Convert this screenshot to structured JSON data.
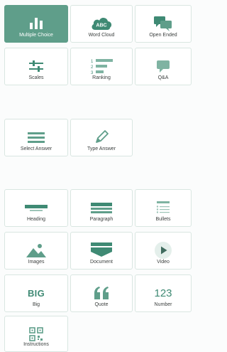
{
  "colors": {
    "accent": "#5f9e8a",
    "icon": "#3f8a74",
    "selected_text": "#ffffff",
    "label": "#3b3f3e"
  },
  "question_types": [
    {
      "label": "Multiple Choice",
      "icon": "bar-chart-icon",
      "selected": true
    },
    {
      "label": "Word Cloud",
      "icon": "word-cloud-icon",
      "icon_text": "ABC"
    },
    {
      "label": "Open Ended",
      "icon": "speech-bubbles-icon"
    },
    {
      "label": "Scales",
      "icon": "sliders-icon"
    },
    {
      "label": "Ranking",
      "icon": "ranking-icon",
      "icon_numbers": [
        "1",
        "2",
        "3"
      ]
    },
    {
      "label": "Q&A",
      "icon": "chat-bubble-icon"
    }
  ],
  "quiz_types": [
    {
      "label": "Select Answer",
      "icon": "list-lines-icon"
    },
    {
      "label": "Type Answer",
      "icon": "pencil-icon"
    }
  ],
  "content_types": [
    {
      "label": "Heading",
      "icon": "heading-icon"
    },
    {
      "label": "Paragraph",
      "icon": "paragraph-icon"
    },
    {
      "label": "Bullets",
      "icon": "bullets-icon"
    },
    {
      "label": "Images",
      "icon": "image-icon"
    },
    {
      "label": "Document",
      "icon": "document-icon"
    },
    {
      "label": "Video",
      "icon": "play-icon"
    },
    {
      "label": "Big",
      "icon": "big-text-icon",
      "icon_text": "BIG"
    },
    {
      "label": "Quote",
      "icon": "quote-icon",
      "icon_text": "“"
    },
    {
      "label": "Number",
      "icon": "number-icon",
      "icon_text": "123"
    },
    {
      "label": "Instructions",
      "icon": "qr-code-icon"
    }
  ]
}
